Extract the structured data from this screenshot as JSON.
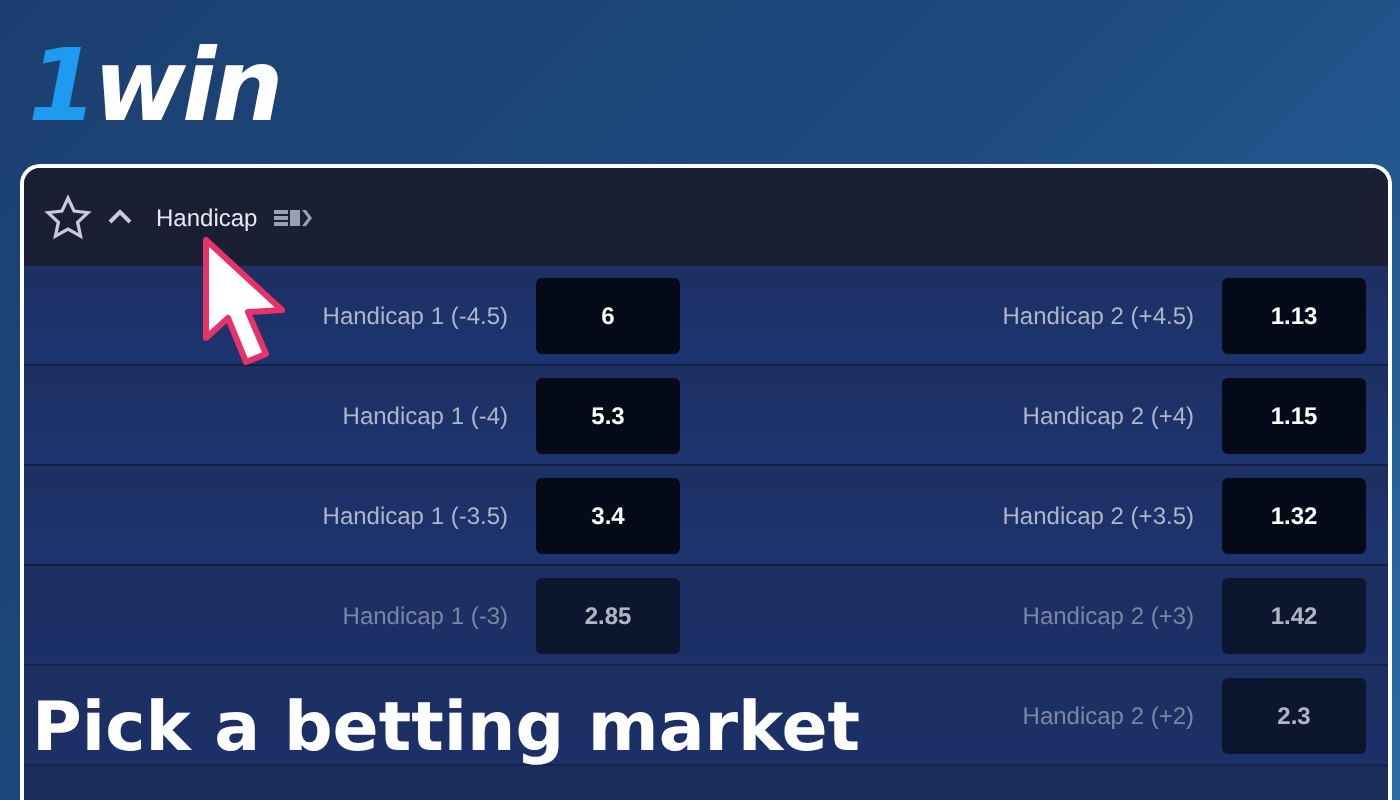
{
  "logo": "1win",
  "market": {
    "title": "Handicap",
    "expanded": true
  },
  "rows": [
    {
      "left_label": "Handicap 1 (-4.5)",
      "left_odds": "6",
      "right_label": "Handicap 2 (+4.5)",
      "right_odds": "1.13"
    },
    {
      "left_label": "Handicap 1 (-4)",
      "left_odds": "5.3",
      "right_label": "Handicap 2 (+4)",
      "right_odds": "1.15"
    },
    {
      "left_label": "Handicap 1 (-3.5)",
      "left_odds": "3.4",
      "right_label": "Handicap 2 (+3.5)",
      "right_odds": "1.32"
    },
    {
      "left_label": "Handicap 1 (-3)",
      "left_odds": "2.85",
      "right_label": "Handicap 2 (+3)",
      "right_odds": "1.42"
    },
    {
      "right_label": "Handicap 2 (+2)",
      "right_odds": "2.3"
    }
  ],
  "caption": "Pick a betting market"
}
